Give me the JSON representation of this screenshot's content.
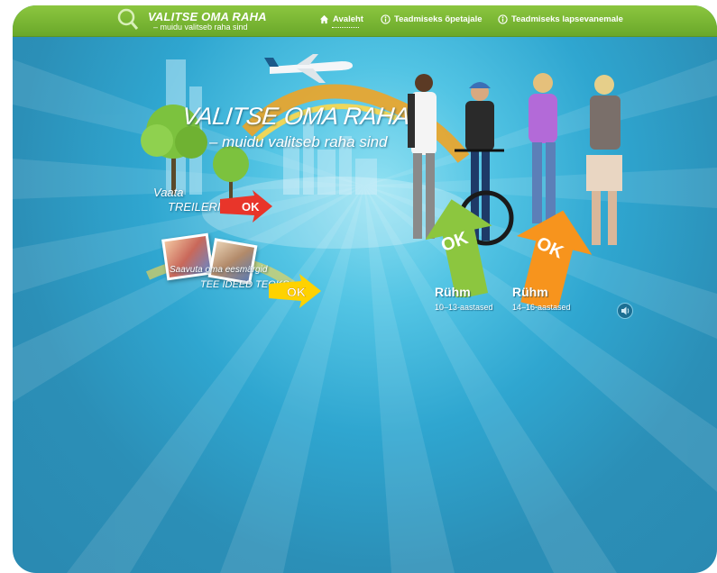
{
  "header": {
    "logo_title": "VALITSE OMA RAHA",
    "logo_subtitle": "– muidu valitseb raha sind"
  },
  "nav": {
    "home": "Avaleht",
    "teacher": "Teadmiseks õpetajale",
    "parent": "Teadmiseks lapsevanemale"
  },
  "hero": {
    "title": "VALITSE OMA RAHA",
    "subtitle": "– muidu valitseb raha sind"
  },
  "trailer": {
    "line1": "Vaata",
    "line2": "TREILERIT",
    "ok": "OK"
  },
  "video": {
    "line1": "Saavuta oma eesmärgid",
    "line2": "TEE IDEED TEOKS",
    "ok": "OK"
  },
  "groups": [
    {
      "label": "Rühm",
      "ages": "10–13-aastased",
      "ok": "OK",
      "color": "#8cc63f"
    },
    {
      "label": "Rühm",
      "ages": "14–16-aastased",
      "ok": "OK",
      "color": "#f7941d"
    }
  ],
  "colors": {
    "accent_green": "#8cc63f",
    "accent_orange": "#f7941d",
    "accent_red": "#e8352a",
    "accent_yellow": "#ffd200",
    "background": "#2a8bb3"
  },
  "icons": {
    "home": "home-icon",
    "info": "info-icon",
    "sound": "speaker-icon",
    "logo": "magnifier-icon"
  }
}
